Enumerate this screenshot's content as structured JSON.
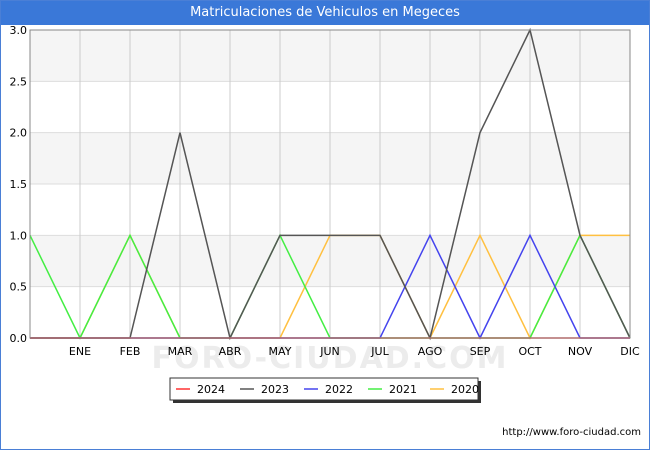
{
  "title": "Matriculaciones de Vehiculos en Megeces",
  "watermark": "FORO-CIUDAD.COM",
  "footer": "http://www.foro-ciudad.com",
  "chart_data": {
    "type": "line",
    "x": [
      "",
      "ENE",
      "FEB",
      "MAR",
      "ABR",
      "MAY",
      "JUN",
      "JUL",
      "AGO",
      "SEP",
      "OCT",
      "NOV",
      "DIC"
    ],
    "ylim": [
      0,
      3.0
    ],
    "yticks": [
      "0.0",
      "0.5",
      "1.0",
      "1.5",
      "2.0",
      "2.5",
      "3.0"
    ],
    "grid": true,
    "legend_position": "bottom",
    "series": [
      {
        "name": "2024",
        "color": "#ff3333",
        "values": [
          0,
          0,
          0,
          0,
          0,
          0,
          0,
          0,
          0,
          0,
          0,
          0,
          0
        ]
      },
      {
        "name": "2023",
        "color": "#555555",
        "values": [
          0,
          0,
          0,
          2,
          0,
          1,
          1,
          1,
          0,
          2,
          3,
          1,
          0
        ]
      },
      {
        "name": "2022",
        "color": "#4444ee",
        "values": [
          0,
          0,
          0,
          0,
          0,
          0,
          0,
          0,
          1,
          0,
          1,
          0,
          0
        ]
      },
      {
        "name": "2021",
        "color": "#44ee44",
        "values": [
          1,
          0,
          1,
          0,
          0,
          1,
          0,
          0,
          0,
          0,
          0,
          1,
          0
        ]
      },
      {
        "name": "2020",
        "color": "#ffc040",
        "values": [
          0,
          0,
          1,
          0,
          0,
          0,
          1,
          1,
          0,
          1,
          0,
          1,
          1
        ]
      }
    ]
  }
}
